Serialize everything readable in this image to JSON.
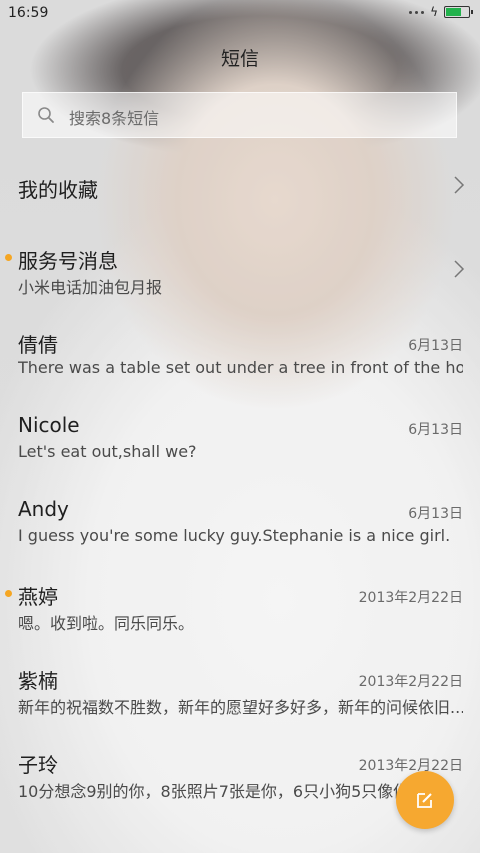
{
  "status_bar": {
    "time": "16:59"
  },
  "header": {
    "title": "短信"
  },
  "search": {
    "placeholder": "搜索8条短信"
  },
  "favorites": {
    "label": "我的收藏"
  },
  "service": {
    "name": "服务号消息",
    "preview": "小米电话加油包月报"
  },
  "conversations": [
    {
      "name": "倩倩",
      "preview": "There was a table set out under a tree in front of the hous",
      "date": "6月13日",
      "unread": false
    },
    {
      "name": "Nicole",
      "preview": "Let's eat out,shall we?",
      "date": "6月13日",
      "unread": false
    },
    {
      "name": "Andy",
      "preview": "I guess you're some lucky guy.Stephanie is a nice girl.",
      "date": "6月13日",
      "unread": false
    },
    {
      "name": "燕婷",
      "preview": "嗯。收到啦。同乐同乐。",
      "date": "2013年2月22日",
      "unread": true
    },
    {
      "name": "紫楠",
      "preview": "新年的祝福数不胜数，新年的愿望好多好多，新年的问候依旧...",
      "date": "2013年2月22日",
      "unread": false
    },
    {
      "name": "子玲",
      "preview": "10分想念9别的你，8张照片7张是你，6只小狗5只像你，...",
      "date": "2013年2月22日",
      "unread": false
    }
  ],
  "colors": {
    "accent": "#f6a830",
    "unread_dot": "#f5a623",
    "battery": "#22b24c"
  },
  "icons": {
    "search": "search-icon",
    "compose": "compose-icon",
    "chevron": "chevron-right-icon"
  }
}
